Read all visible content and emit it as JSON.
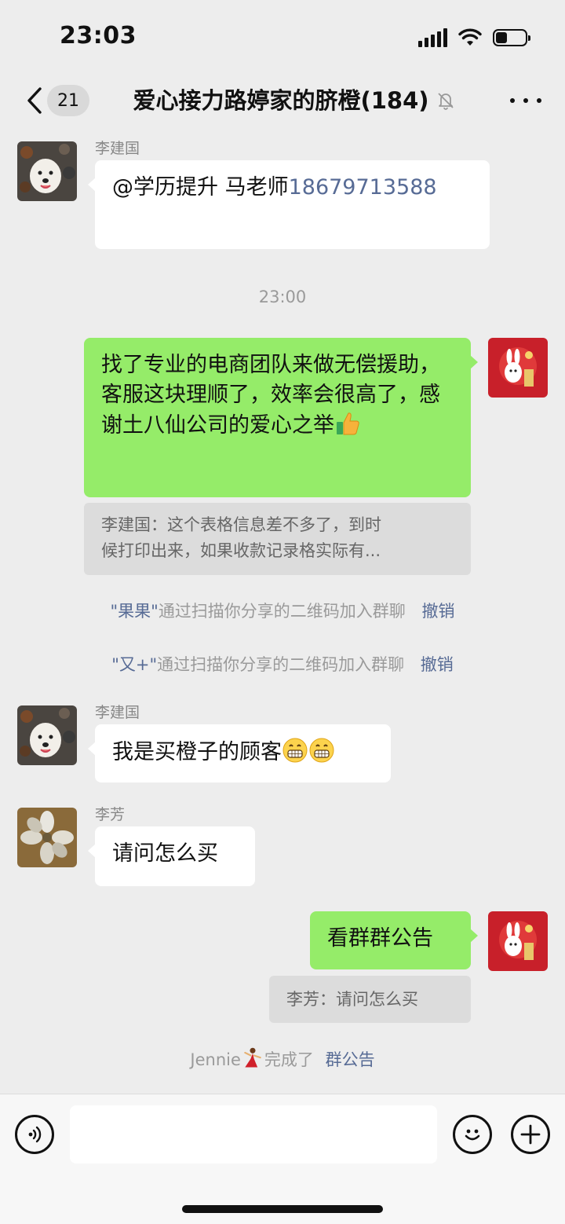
{
  "status_bar": {
    "time": "23:03",
    "battery_level": 0.4
  },
  "header": {
    "unread_count": "21",
    "title": "爱心接力路婷家的脐橙(184)"
  },
  "messages": {
    "m1": {
      "sender": "李建国",
      "prefix": "@学历提升 马老师",
      "mention": "18679713588"
    },
    "time_divider": "23:00",
    "m2": {
      "text": "找了专业的电商团队来做无偿援助，客服这块理顺了，效率会很高了，感谢土八仙公司的爱心之举",
      "quote_line1": "李建国：这个表格信息差不多了，到时",
      "quote_line2": "候打印出来，如果收款记录格实际有..."
    },
    "sys1": {
      "name": "\"果果\"",
      "text": "通过扫描你分享的二维码加入群聊",
      "action": "撤销"
    },
    "sys2": {
      "name": "\"又+\"",
      "text": "通过扫描你分享的二维码加入群聊",
      "action": "撤销"
    },
    "m3": {
      "sender": "李建国",
      "text": "我是买橙子的顾客"
    },
    "m4": {
      "sender": "李芳",
      "text": "请问怎么买"
    },
    "m5": {
      "text": "看群群公告",
      "quote": "李芳：请问怎么买"
    },
    "sys3": {
      "prefix": "Jennie",
      "text": "完成了",
      "link": "群公告"
    }
  },
  "icons": {
    "back": "chevron-left-icon",
    "mute": "bell-off-icon",
    "more": "more-dots-icon",
    "voice": "voice-icon",
    "emoji": "emoji-icon",
    "add": "plus-icon"
  },
  "colors": {
    "background": "#ededed",
    "my_bubble": "#95ec69",
    "other_bubble": "#ffffff",
    "link": "#576b95"
  }
}
